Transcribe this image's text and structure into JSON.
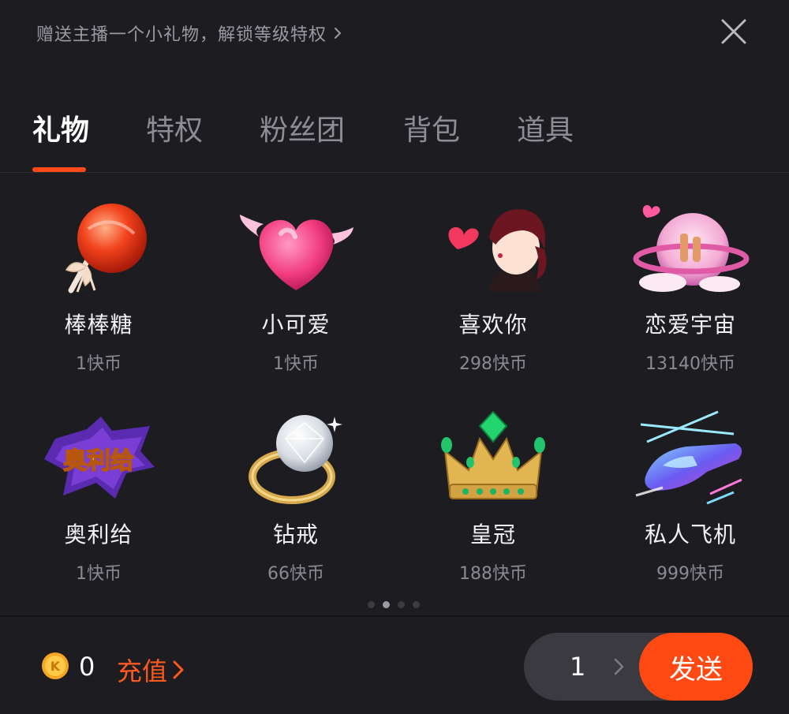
{
  "header": {
    "promo_text": "赠送主播一个小礼物，解锁等级特权"
  },
  "tabs": [
    {
      "label": "礼物"
    },
    {
      "label": "特权"
    },
    {
      "label": "粉丝团"
    },
    {
      "label": "背包"
    },
    {
      "label": "道具"
    }
  ],
  "active_tab": "礼物",
  "gifts": [
    {
      "name": "棒棒糖",
      "price": "1快币",
      "icon": "lollipop-icon"
    },
    {
      "name": "小可爱",
      "price": "1快币",
      "icon": "winged-heart-icon"
    },
    {
      "name": "喜欢你",
      "price": "298快币",
      "icon": "kiss-heart-icon"
    },
    {
      "name": "恋爱宇宙",
      "price": "13140快币",
      "icon": "love-universe-icon"
    },
    {
      "name": "奥利给",
      "price": "1快币",
      "icon": "aoligei-badge-icon"
    },
    {
      "name": "钻戒",
      "price": "66快币",
      "icon": "diamond-ring-icon"
    },
    {
      "name": "皇冠",
      "price": "188快币",
      "icon": "crown-icon"
    },
    {
      "name": "私人飞机",
      "price": "999快币",
      "icon": "private-jet-icon"
    }
  ],
  "pager": {
    "total": 4,
    "active": 2
  },
  "footer": {
    "coin_letter": "K",
    "balance": "0",
    "recharge_label": "充值",
    "quantity": "1",
    "send_label": "发送"
  },
  "colors": {
    "accent": "#fe4a12",
    "background": "#1c1c21"
  }
}
